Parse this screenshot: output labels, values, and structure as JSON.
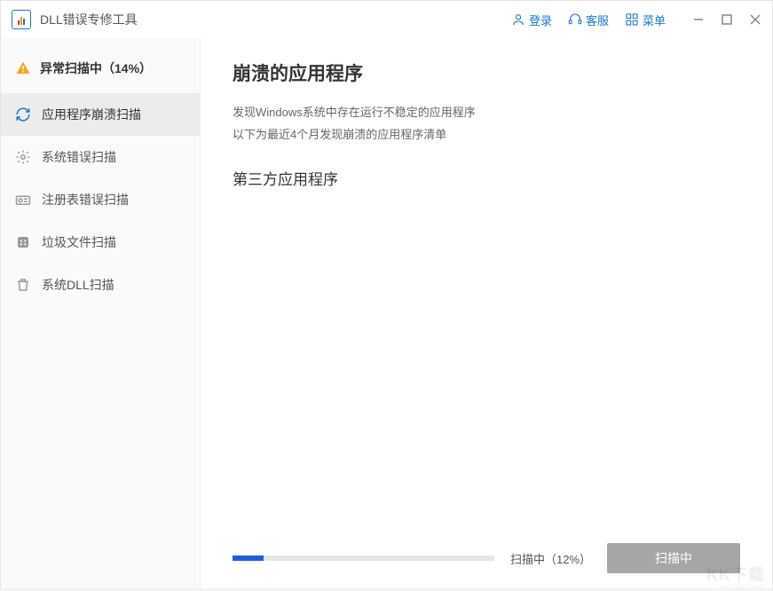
{
  "app": {
    "title": "DLL错误专修工具"
  },
  "titlebar": {
    "login": "登录",
    "support": "客服",
    "menu": "菜单"
  },
  "sidebar": {
    "status": "异常扫描中（14%）",
    "items": [
      {
        "label": "应用程序崩溃扫描",
        "icon": "refresh-icon",
        "selected": true
      },
      {
        "label": "系统错误扫描",
        "icon": "gear-icon",
        "selected": false
      },
      {
        "label": "注册表错误扫描",
        "icon": "registry-icon",
        "selected": false
      },
      {
        "label": "垃圾文件扫描",
        "icon": "junk-icon",
        "selected": false
      },
      {
        "label": "系统DLL扫描",
        "icon": "trash-icon",
        "selected": false
      }
    ]
  },
  "main": {
    "heading": "崩溃的应用程序",
    "desc_line1": "发现Windows系统中存在运行不稳定的应用程序",
    "desc_line2": "以下为最近4个月发现崩溃的应用程序清单",
    "subheading": "第三方应用程序"
  },
  "progress": {
    "percent": 12,
    "label": "扫描中（12%）",
    "button": "扫描中"
  },
  "watermark": {
    "main": "KK下载",
    "sub": "www.kkx.net"
  }
}
